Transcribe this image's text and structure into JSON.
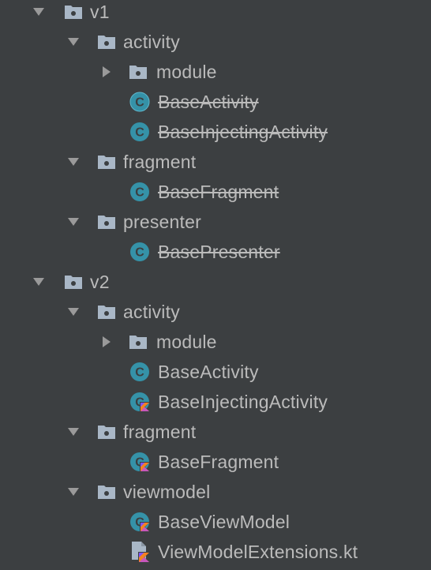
{
  "colors": {
    "background": "#3C3F41",
    "text": "#BBBBBB",
    "folder": "#A9B7C6",
    "class_circle": "#40B6E0",
    "kotlin_orange": "#F58220",
    "kotlin_purple": "#7F52FF"
  },
  "tree": {
    "nodes": [
      {
        "name": "v1",
        "type": "package",
        "expanded": true,
        "strike": false
      },
      {
        "name": "activity",
        "type": "package",
        "expanded": true,
        "strike": false
      },
      {
        "name": "module",
        "type": "package",
        "expanded": false,
        "strike": false
      },
      {
        "name": "BaseActivity",
        "type": "java-class",
        "strike": true
      },
      {
        "name": "BaseInjectingActivity",
        "type": "java-class",
        "strike": true
      },
      {
        "name": "fragment",
        "type": "package",
        "expanded": true,
        "strike": false
      },
      {
        "name": "BaseFragment",
        "type": "java-class",
        "strike": true
      },
      {
        "name": "presenter",
        "type": "package",
        "expanded": true,
        "strike": false
      },
      {
        "name": "BasePresenter",
        "type": "java-class",
        "strike": true
      },
      {
        "name": "v2",
        "type": "package",
        "expanded": true,
        "strike": false
      },
      {
        "name": "activity",
        "type": "package",
        "expanded": true,
        "strike": false
      },
      {
        "name": "module",
        "type": "package",
        "expanded": false,
        "strike": false
      },
      {
        "name": "BaseActivity",
        "type": "java-class",
        "strike": false
      },
      {
        "name": "BaseInjectingActivity",
        "type": "kotlin-class",
        "strike": false
      },
      {
        "name": "fragment",
        "type": "package",
        "expanded": true,
        "strike": false
      },
      {
        "name": "BaseFragment",
        "type": "kotlin-class",
        "strike": false
      },
      {
        "name": "viewmodel",
        "type": "package",
        "expanded": true,
        "strike": false
      },
      {
        "name": "BaseViewModel",
        "type": "kotlin-class",
        "strike": false
      },
      {
        "name": "ViewModelExtensions.kt",
        "type": "kotlin-file",
        "strike": false
      }
    ]
  }
}
